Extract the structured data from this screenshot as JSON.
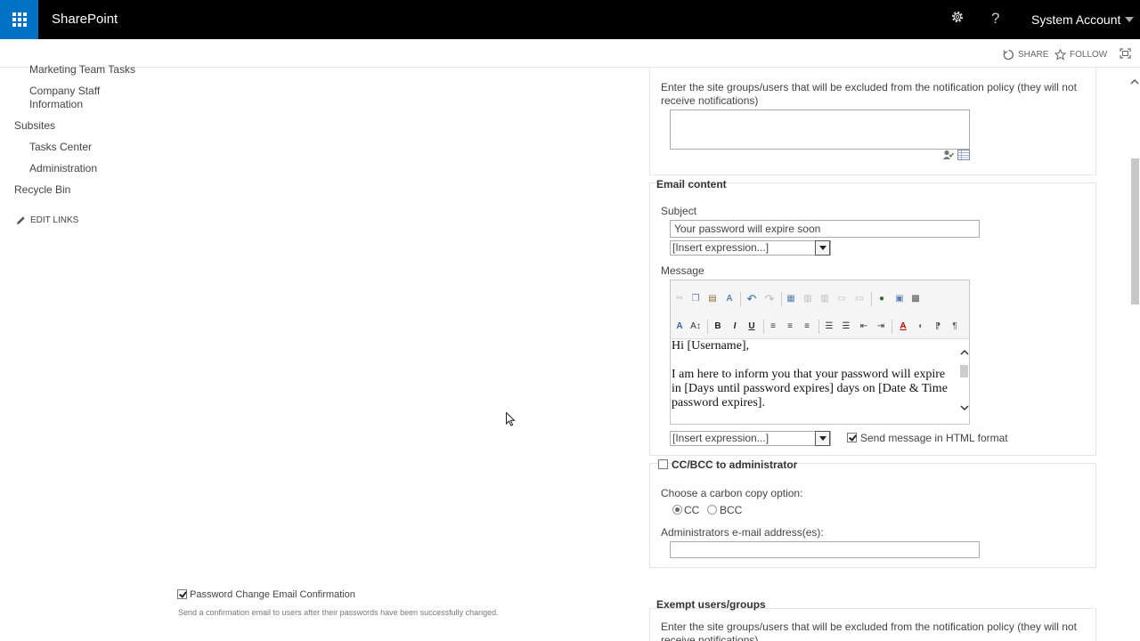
{
  "suitebar": {
    "brand": "SharePoint",
    "account": "System Account",
    "settings_icon": "gear-icon",
    "help_label": "?"
  },
  "ribbon": {
    "share": "SHARE",
    "follow": "FOLLOW"
  },
  "nav": {
    "items": [
      {
        "label": "Marketing Team Tasks"
      },
      {
        "label": "Company Staff"
      },
      {
        "label": "Information"
      },
      {
        "label": "Subsites"
      },
      {
        "label": "Tasks Center"
      },
      {
        "label": "Administration"
      },
      {
        "label": "Recycle Bin"
      }
    ],
    "edit_links": "EDIT LINKS"
  },
  "exempt_top": {
    "description_line1": "Enter the site groups/users that will be excluded from the notification policy (they will not",
    "description_line2": "receive notifications)"
  },
  "email_content": {
    "title": "Email content",
    "subject_label": "Subject",
    "subject_value": "Your password will expire soon",
    "insert_expression": "[Insert expression...]",
    "message_label": "Message",
    "message_lines": [
      "Hi [Username],",
      "",
      "I am here to inform you that your password will expire",
      "in [Days until password expires] days on [Date & Time",
      "password expires]."
    ],
    "insert_expression_2": "[Insert expression...]",
    "html_format_label": "Send message in HTML format",
    "html_format_checked": true
  },
  "ccbcc": {
    "title": "CC/BCC to administrator",
    "checked": false,
    "option_label": "Choose a carbon copy option:",
    "cc_label": "CC",
    "bcc_label": "BCC",
    "selected": "CC",
    "admin_label": "Administrators e-mail address(es):"
  },
  "password_change": {
    "label": "Password Change Email Confirmation",
    "checked": true,
    "description": "Send a confirmation email to users after their passwords have been successfully changed."
  },
  "exempt_bottom": {
    "title": "Exempt users/groups",
    "description_line1": "Enter the site groups/users that will be excluded from the notification policy (they will not",
    "description_line2": "receive notifications)"
  },
  "colors": {
    "suitebar": "#000000",
    "waffle": "#0072c6",
    "text": "#444444"
  }
}
